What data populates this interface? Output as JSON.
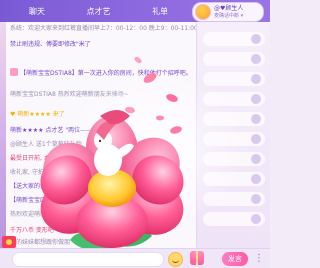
{
  "tabs": [
    {
      "label": "聊天",
      "active": false
    },
    {
      "label": "点才艺",
      "active": false
    },
    {
      "label": "礼单",
      "active": false
    }
  ],
  "user": {
    "name": "@♥顾生人",
    "control": "麦确话中断 ▾"
  },
  "chat_lines": [
    {
      "prefix": "",
      "text": "系统：欢迎大家来到红裤直播间早上7：00-12：00 晚上9：00-11:00免费点歌哦"
    },
    {
      "prefix": "",
      "text": "禁止刷违规、傅要即修改\"米了"
    },
    {
      "prefix": "♥",
      "text": "【萌新宝宝DSTIA8】第一次进入你的房间，快和他打个招呼吧。"
    },
    {
      "prefix": "",
      "text": "萌新宝宝DSTIA8 热烈欢迎萌新朋友来捧场~"
    },
    {
      "prefix": "",
      "text": "♥ 萌新★★★★ 来了"
    },
    {
      "prefix": "",
      "text": "萌新★★★★ 点才艺 \"两位——科目\""
    },
    {
      "prefix": "",
      "text": "@顾生人 送1个草莓味礼物"
    },
    {
      "prefix": "",
      "text": "最受日开前, 本轮最受欢迎, 谢谢 @顾生人"
    },
    {
      "prefix": "",
      "text": "收礼家, 守护你心中的爱"
    },
    {
      "prefix": "",
      "text": "【送大家的扑"
    },
    {
      "prefix": "",
      "text": "【萌新宝宝DSTIA8"
    },
    {
      "prefix": "",
      "text": "热烈欢迎萌新朋友, 管相下没有"
    },
    {
      "prefix": "",
      "text": "千万八币 变形吧"
    },
    {
      "prefix": "",
      "text": "她的妹妹都想跟你做朋"
    }
  ],
  "input": {
    "placeholder": "",
    "send_label": "发言"
  },
  "colors": {
    "tabbar": "#8e6ae0",
    "accent": "#ff5aa8",
    "highlight_name": "#7446c8"
  },
  "icons": [
    "smile-icon",
    "gift-icon",
    "more-icon",
    "redpacket-icon",
    "flower-effect"
  ]
}
